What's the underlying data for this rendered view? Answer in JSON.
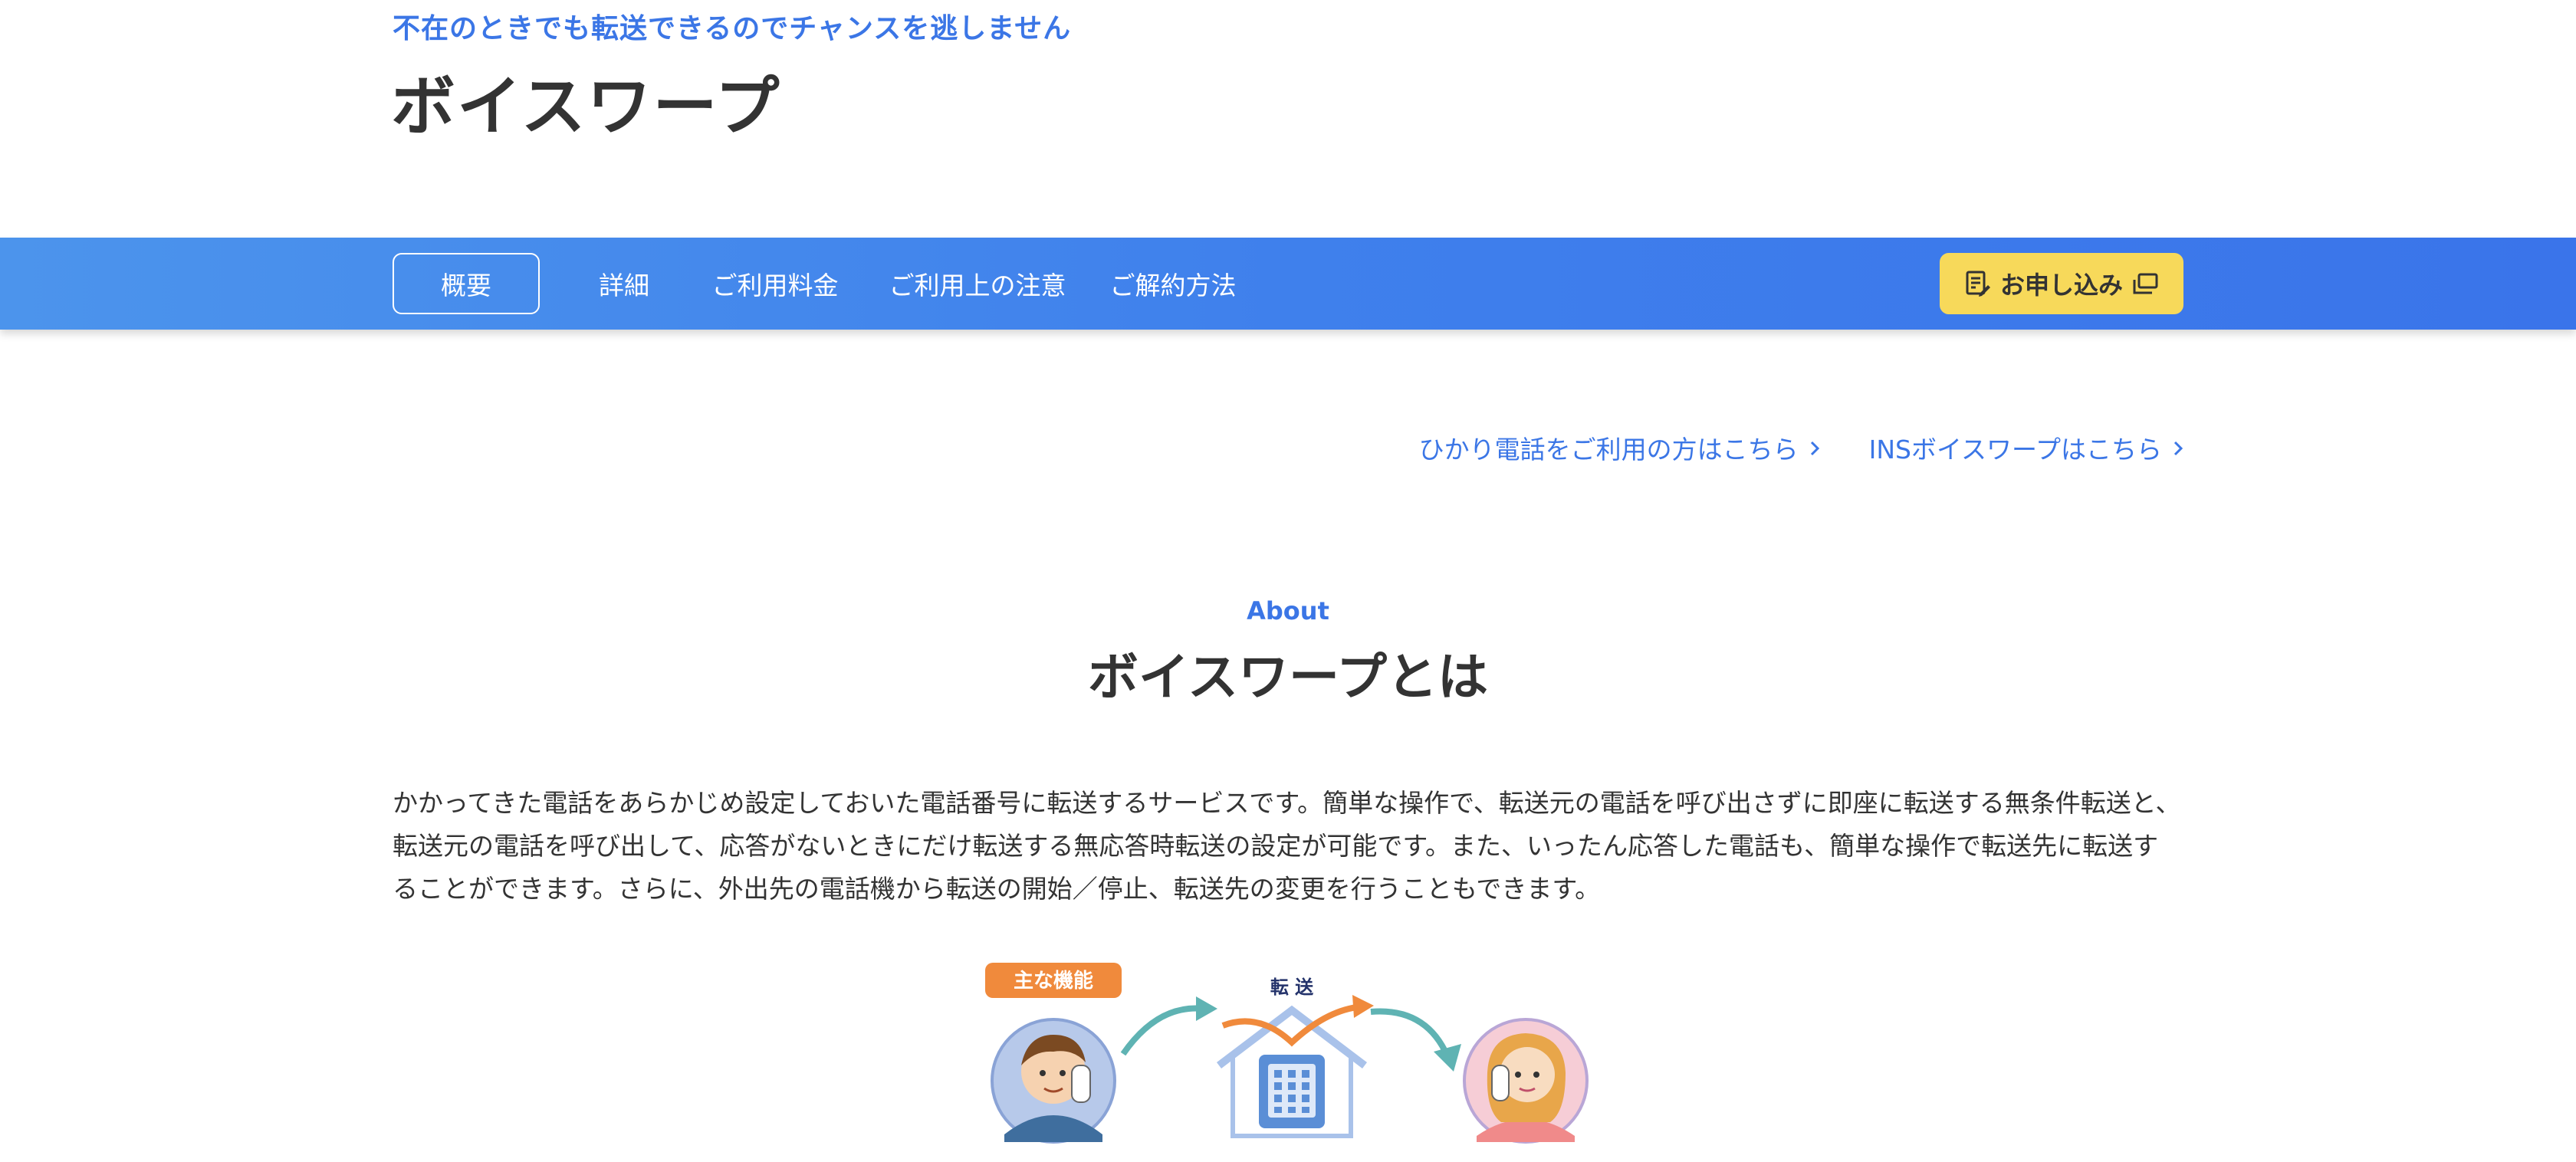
{
  "header": {
    "tagline": "不在のときでも転送できるのでチャンスを逃しません",
    "title": "ボイスワープ"
  },
  "nav": {
    "tabs": [
      {
        "label": "概要",
        "active": true
      },
      {
        "label": "詳細",
        "active": false
      },
      {
        "label": "ご利用料金",
        "active": false
      },
      {
        "label": "ご利用上の注意",
        "active": false
      },
      {
        "label": "ご解約方法",
        "active": false
      }
    ],
    "apply_label": "お申し込み",
    "apply_icons": [
      "form-icon",
      "external-window-icon"
    ]
  },
  "links": [
    {
      "label": "ひかり電話をご利用の方はこちら",
      "icon": "chevron-right-icon"
    },
    {
      "label": "INSボイスワープはこちら",
      "icon": "chevron-right-icon"
    }
  ],
  "about": {
    "eyebrow": "About",
    "title": "ボイスワープとは",
    "body": "かかってきた電話をあらかじめ設定しておいた電話番号に転送するサービスです。簡単な操作で、転送元の電話を呼び出さずに即座に転送する無条件転送と、転送元の電話を呼び出して、応答がないときにだけ転送する無応答時転送の設定が可能です。また、いったん応答した電話も、簡単な操作で転送先に転送することができます。さらに、外出先の電話機から転送の開始／停止、転送先の変更を行うこともできます。"
  },
  "illustration": {
    "badge": "主な機能",
    "transfer_label": "転 送"
  },
  "colors": {
    "accent_blue": "#3b76e6",
    "nav_start": "#4c94ec",
    "nav_end": "#3a74ea",
    "apply_yellow": "#f7d95a",
    "badge_orange": "#f08a3c",
    "arrow_teal": "#5fb3b3"
  }
}
